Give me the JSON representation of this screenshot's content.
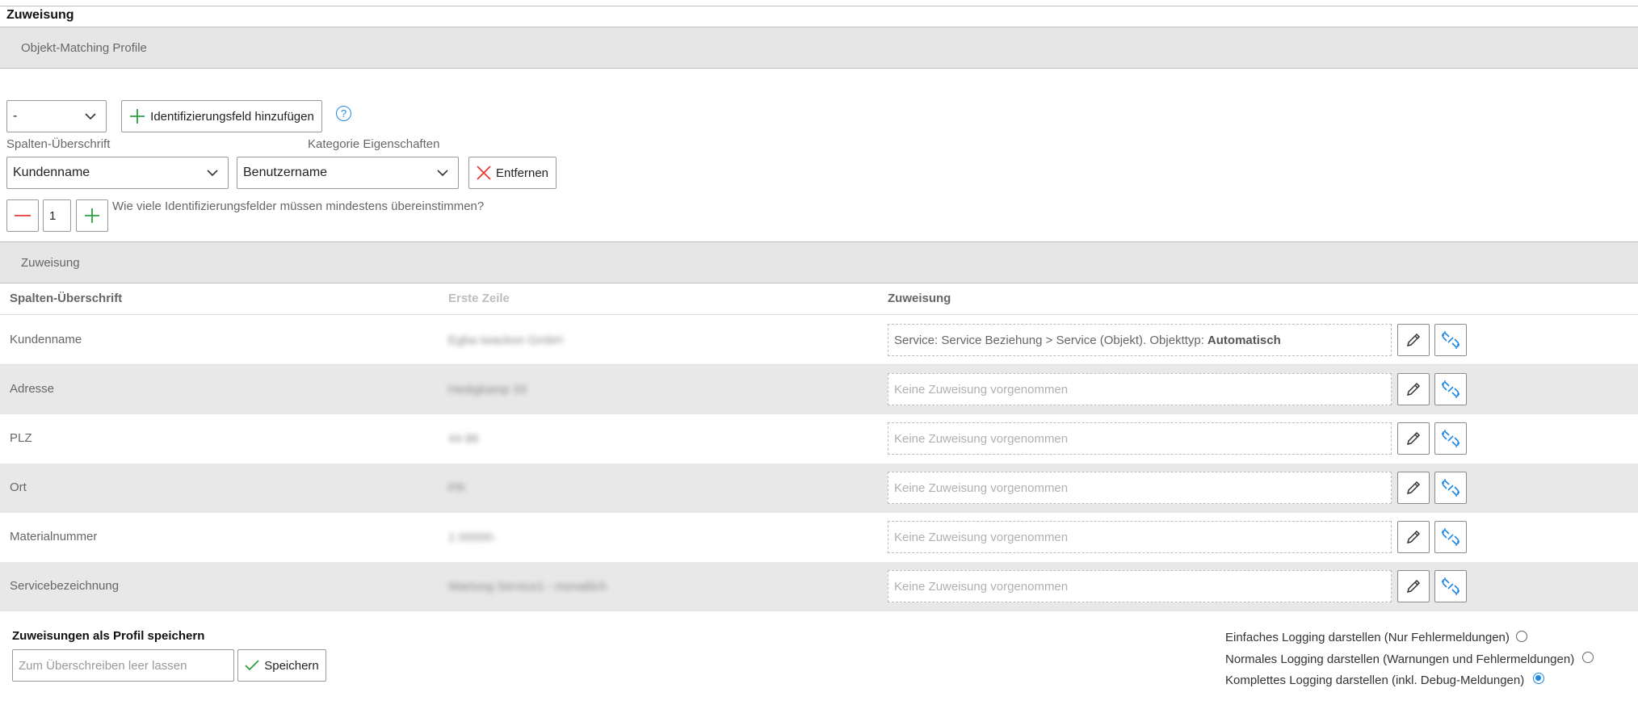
{
  "section": {
    "title": "Zuweisung"
  },
  "profile_bar": {
    "title": "Objekt-Matching Profile"
  },
  "profile": {
    "select_value": "-",
    "add_field_label": "Identifizierungsfeld hinzufügen",
    "help_symbol": "?"
  },
  "identifier": {
    "column_header_label": "Spalten-Überschrift",
    "category_label": "Kategorie Eigenschaften",
    "column_value": "Kundenname",
    "category_value": "Benutzername",
    "remove_label": "Entfernen"
  },
  "match_count": {
    "value": "1",
    "question": "Wie viele Identifizierungsfelder müssen mindestens übereinstimmen?"
  },
  "assignment_bar": {
    "title": "Zuweisung"
  },
  "table": {
    "headers": [
      "Spalten-Überschrift",
      "Erste Zeile",
      "Zuweisung"
    ],
    "rows": [
      {
        "name": "Kundenname",
        "first": "Egba Iwackon GmbH",
        "assignment": "Service: Service Beziehung > Service (Objekt). Objekttyp:",
        "assignment_bold": "Automatisch"
      },
      {
        "name": "Adresse",
        "first": "Hedigkamp 33",
        "assignment": "Keine Zuweisung vorgenommen",
        "assignment_bold": ""
      },
      {
        "name": "PLZ",
        "first": "44 86",
        "assignment": "Keine Zuweisung vorgenommen",
        "assignment_bold": ""
      },
      {
        "name": "Ort",
        "first": "PR",
        "assignment": "Keine Zuweisung vorgenommen",
        "assignment_bold": ""
      },
      {
        "name": "Materialnummer",
        "first": "1 00000-",
        "assignment": "Keine Zuweisung vorgenommen",
        "assignment_bold": ""
      },
      {
        "name": "Servicebezeichnung",
        "first": "Wartung Service1 - monatlich",
        "assignment": "Keine Zuweisung vorgenommen",
        "assignment_bold": ""
      }
    ]
  },
  "save_profile": {
    "title": "Zuweisungen als Profil speichern",
    "placeholder": "Zum Überschreiben leer lassen",
    "save_label": "Speichern"
  },
  "logging": {
    "options": [
      {
        "label": "Einfaches Logging darstellen (Nur Fehlermeldungen)",
        "selected": false
      },
      {
        "label": "Normales Logging darstellen (Warnungen und Fehlermeldungen)",
        "selected": false
      },
      {
        "label": "Komplettes Logging darstellen (inkl. Debug-Meldungen)",
        "selected": true
      }
    ]
  },
  "colors": {
    "accent": "#1e88e5",
    "plus": "#2e9e44",
    "danger": "#e53935",
    "bar": "#e6e6e6"
  }
}
